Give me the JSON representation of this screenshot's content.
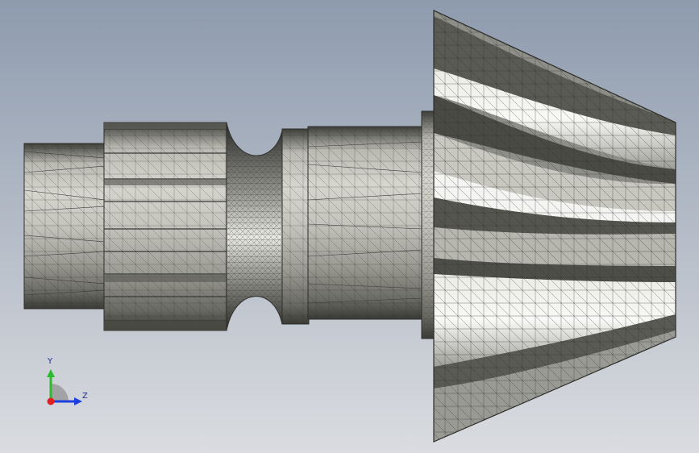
{
  "viewport": {
    "background_top": "#8E9BAE",
    "background_bottom": "#DADCE0"
  },
  "model": {
    "mesh_dark": "#4A4A44",
    "mesh_line": "#2E2E2A",
    "face_light": "#D8D8D0",
    "face_mid": "#A8A8A0",
    "face_shade": "#70706A",
    "highlight": "#FFFFFF"
  },
  "triad": {
    "y_label": "Y",
    "z_label": "Z",
    "y_color": "#2EBA2E",
    "z_color": "#1E3FE0",
    "x_color": "#E02020",
    "label_color": "#1E2A8A"
  }
}
